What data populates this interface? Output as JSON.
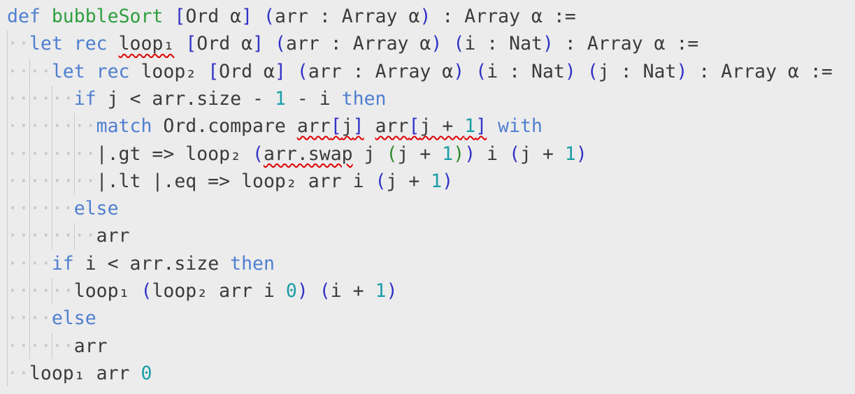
{
  "editor": {
    "language": "Lean",
    "colors": {
      "background": "#ececec",
      "text": "#3b3b3b",
      "keyword": "#4f7fd0",
      "definition": "#2e9e3e",
      "number": "#1a9ea8",
      "bracket_level_1": "#3232c8",
      "bracket_level_2": "#2e8b2e",
      "whitespace_marker": "#c6c6c6",
      "error_squiggle": "#e00000"
    },
    "lines": [
      [
        {
          "t": "def",
          "c": "kw"
        },
        {
          "t": " "
        },
        {
          "t": "bubbleSort",
          "c": "fn"
        },
        {
          "t": " "
        },
        {
          "t": "[",
          "c": "p1"
        },
        {
          "t": "Ord α"
        },
        {
          "t": "]",
          "c": "p1"
        },
        {
          "t": " "
        },
        {
          "t": "(",
          "c": "p1"
        },
        {
          "t": "arr : Array α"
        },
        {
          "t": ")",
          "c": "p1"
        },
        {
          "t": " : Array α :="
        }
      ],
      [
        {
          "t": "··",
          "c": "ws"
        },
        {
          "t": "let rec",
          "c": "kw"
        },
        {
          "t": " "
        },
        {
          "t": "loop₁",
          "e": true
        },
        {
          "t": " "
        },
        {
          "t": "[",
          "c": "p1"
        },
        {
          "t": "Ord α"
        },
        {
          "t": "]",
          "c": "p1"
        },
        {
          "t": " "
        },
        {
          "t": "(",
          "c": "p1"
        },
        {
          "t": "arr : Array α"
        },
        {
          "t": ")",
          "c": "p1"
        },
        {
          "t": " "
        },
        {
          "t": "(",
          "c": "p1"
        },
        {
          "t": "i : Nat"
        },
        {
          "t": ")",
          "c": "p1"
        },
        {
          "t": " : Array α :="
        }
      ],
      [
        {
          "t": "····",
          "c": "ws"
        },
        {
          "t": "let rec",
          "c": "kw"
        },
        {
          "t": " loop₂ "
        },
        {
          "t": "[",
          "c": "p1"
        },
        {
          "t": "Ord α"
        },
        {
          "t": "]",
          "c": "p1"
        },
        {
          "t": " "
        },
        {
          "t": "(",
          "c": "p1"
        },
        {
          "t": "arr : Array α"
        },
        {
          "t": ")",
          "c": "p1"
        },
        {
          "t": " "
        },
        {
          "t": "(",
          "c": "p1"
        },
        {
          "t": "i : Nat"
        },
        {
          "t": ")",
          "c": "p1"
        },
        {
          "t": " "
        },
        {
          "t": "(",
          "c": "p1"
        },
        {
          "t": "j : Nat"
        },
        {
          "t": ")",
          "c": "p1"
        },
        {
          "t": " : Array α :="
        }
      ],
      [
        {
          "t": "······",
          "c": "ws"
        },
        {
          "t": "if",
          "c": "kw"
        },
        {
          "t": " j < arr.size - "
        },
        {
          "t": "1",
          "c": "num"
        },
        {
          "t": " - i "
        },
        {
          "t": "then",
          "c": "kw"
        }
      ],
      [
        {
          "t": "········",
          "c": "ws"
        },
        {
          "t": "match",
          "c": "kw"
        },
        {
          "t": " Ord.compare "
        },
        {
          "t": "arr",
          "e": true
        },
        {
          "t": "[",
          "c": "p1",
          "e": true
        },
        {
          "t": "j",
          "e": true
        },
        {
          "t": "]",
          "c": "p1",
          "e": true
        },
        {
          "t": " "
        },
        {
          "t": "arr",
          "e": true
        },
        {
          "t": "[",
          "c": "p1",
          "e": true
        },
        {
          "t": "j + ",
          "e": true
        },
        {
          "t": "1",
          "c": "num",
          "e": true
        },
        {
          "t": "]",
          "c": "p1",
          "e": true
        },
        {
          "t": " "
        },
        {
          "t": "with",
          "c": "kw"
        }
      ],
      [
        {
          "t": "········",
          "c": "ws"
        },
        {
          "t": "|.gt => loop₂ "
        },
        {
          "t": "(",
          "c": "p1"
        },
        {
          "t": "arr.swap",
          "e": true
        },
        {
          "t": " j "
        },
        {
          "t": "(",
          "c": "p2"
        },
        {
          "t": "j + "
        },
        {
          "t": "1",
          "c": "num"
        },
        {
          "t": ")",
          "c": "p2"
        },
        {
          "t": ")",
          "c": "p1"
        },
        {
          "t": " i "
        },
        {
          "t": "(",
          "c": "p1"
        },
        {
          "t": "j + "
        },
        {
          "t": "1",
          "c": "num"
        },
        {
          "t": ")",
          "c": "p1"
        }
      ],
      [
        {
          "t": "········",
          "c": "ws"
        },
        {
          "t": "|.lt |.eq => loop₂ arr i "
        },
        {
          "t": "(",
          "c": "p1"
        },
        {
          "t": "j + "
        },
        {
          "t": "1",
          "c": "num"
        },
        {
          "t": ")",
          "c": "p1"
        }
      ],
      [
        {
          "t": "······",
          "c": "ws"
        },
        {
          "t": "else",
          "c": "kw"
        }
      ],
      [
        {
          "t": "········",
          "c": "ws"
        },
        {
          "t": "arr"
        }
      ],
      [
        {
          "t": "····",
          "c": "ws"
        },
        {
          "t": "if",
          "c": "kw"
        },
        {
          "t": " i < arr.size "
        },
        {
          "t": "then",
          "c": "kw"
        }
      ],
      [
        {
          "t": "······",
          "c": "ws"
        },
        {
          "t": "loop₁ "
        },
        {
          "t": "(",
          "c": "p1"
        },
        {
          "t": "loop₂ arr i "
        },
        {
          "t": "0",
          "c": "num"
        },
        {
          "t": ")",
          "c": "p1"
        },
        {
          "t": " "
        },
        {
          "t": "(",
          "c": "p1"
        },
        {
          "t": "i + "
        },
        {
          "t": "1",
          "c": "num"
        },
        {
          "t": ")",
          "c": "p1"
        }
      ],
      [
        {
          "t": "····",
          "c": "ws"
        },
        {
          "t": "else",
          "c": "kw"
        }
      ],
      [
        {
          "t": "······",
          "c": "ws"
        },
        {
          "t": "arr"
        }
      ],
      [
        {
          "t": "··",
          "c": "ws"
        },
        {
          "t": "loop₁ arr "
        },
        {
          "t": "0",
          "c": "num"
        }
      ]
    ]
  }
}
